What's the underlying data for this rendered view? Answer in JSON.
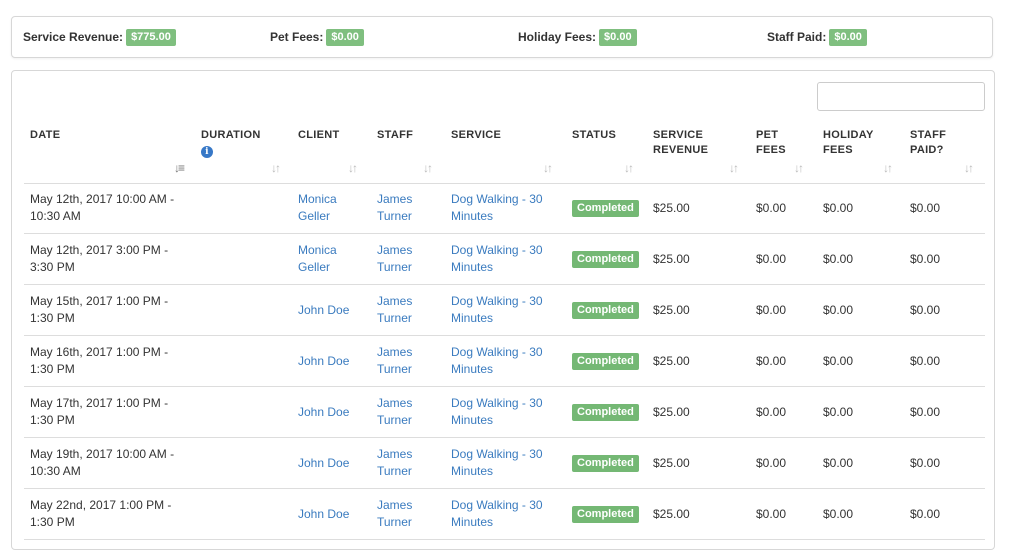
{
  "summary": {
    "service_revenue": {
      "label": "Service Revenue:",
      "value": "$775.00"
    },
    "pet_fees": {
      "label": "Pet Fees:",
      "value": "$0.00"
    },
    "holiday_fees": {
      "label": "Holiday Fees:",
      "value": "$0.00"
    },
    "staff_paid": {
      "label": "Staff Paid:",
      "value": "$0.00"
    }
  },
  "search": {
    "value": "",
    "placeholder": ""
  },
  "columns": {
    "date": "DATE",
    "duration": "DURATION",
    "client": "CLIENT",
    "staff": "STAFF",
    "service": "SERVICE",
    "status": "STATUS",
    "service_revenue_1": "SERVICE",
    "service_revenue_2": "REVENUE",
    "pet_fees_1": "PET",
    "pet_fees_2": "FEES",
    "holiday_fees_1": "HOLIDAY",
    "holiday_fees_2": "FEES",
    "staff_paid_1": "STAFF",
    "staff_paid_2": "PAID?"
  },
  "icons": {
    "info": "info-icon",
    "sort": "sort-icon",
    "sort_active": "sort-asc-icon"
  },
  "colors": {
    "badge_green": "#74b874",
    "link_blue": "#3a7bbf",
    "info_blue": "#3778c7"
  },
  "rows": [
    {
      "date1": "May 12th, 2017 10:00 AM -",
      "date2": "10:30 AM",
      "client1": "Monica",
      "client2": "Geller",
      "staff1": "James",
      "staff2": "Turner",
      "service1": "Dog Walking - 30",
      "service2": "Minutes",
      "status": "Completed",
      "revenue": "$25.00",
      "pet": "$0.00",
      "holiday": "$0.00",
      "paid": "$0.00"
    },
    {
      "date1": "May 12th, 2017 3:00 PM -",
      "date2": "3:30 PM",
      "client1": "Monica",
      "client2": "Geller",
      "staff1": "James",
      "staff2": "Turner",
      "service1": "Dog Walking - 30",
      "service2": "Minutes",
      "status": "Completed",
      "revenue": "$25.00",
      "pet": "$0.00",
      "holiday": "$0.00",
      "paid": "$0.00"
    },
    {
      "date1": "May 15th, 2017 1:00 PM -",
      "date2": "1:30 PM",
      "client1": "John Doe",
      "client2": "",
      "staff1": "James",
      "staff2": "Turner",
      "service1": "Dog Walking - 30",
      "service2": "Minutes",
      "status": "Completed",
      "revenue": "$25.00",
      "pet": "$0.00",
      "holiday": "$0.00",
      "paid": "$0.00"
    },
    {
      "date1": "May 16th, 2017 1:00 PM -",
      "date2": "1:30 PM",
      "client1": "John Doe",
      "client2": "",
      "staff1": "James",
      "staff2": "Turner",
      "service1": "Dog Walking - 30",
      "service2": "Minutes",
      "status": "Completed",
      "revenue": "$25.00",
      "pet": "$0.00",
      "holiday": "$0.00",
      "paid": "$0.00"
    },
    {
      "date1": "May 17th, 2017 1:00 PM -",
      "date2": "1:30 PM",
      "client1": "John Doe",
      "client2": "",
      "staff1": "James",
      "staff2": "Turner",
      "service1": "Dog Walking - 30",
      "service2": "Minutes",
      "status": "Completed",
      "revenue": "$25.00",
      "pet": "$0.00",
      "holiday": "$0.00",
      "paid": "$0.00"
    },
    {
      "date1": "May 19th, 2017 10:00 AM -",
      "date2": "10:30 AM",
      "client1": "John Doe",
      "client2": "",
      "staff1": "James",
      "staff2": "Turner",
      "service1": "Dog Walking - 30",
      "service2": "Minutes",
      "status": "Completed",
      "revenue": "$25.00",
      "pet": "$0.00",
      "holiday": "$0.00",
      "paid": "$0.00"
    },
    {
      "date1": "May 22nd, 2017 1:00 PM -",
      "date2": "1:30 PM",
      "client1": "John Doe",
      "client2": "",
      "staff1": "James",
      "staff2": "Turner",
      "service1": "Dog Walking - 30",
      "service2": "Minutes",
      "status": "Completed",
      "revenue": "$25.00",
      "pet": "$0.00",
      "holiday": "$0.00",
      "paid": "$0.00"
    }
  ]
}
